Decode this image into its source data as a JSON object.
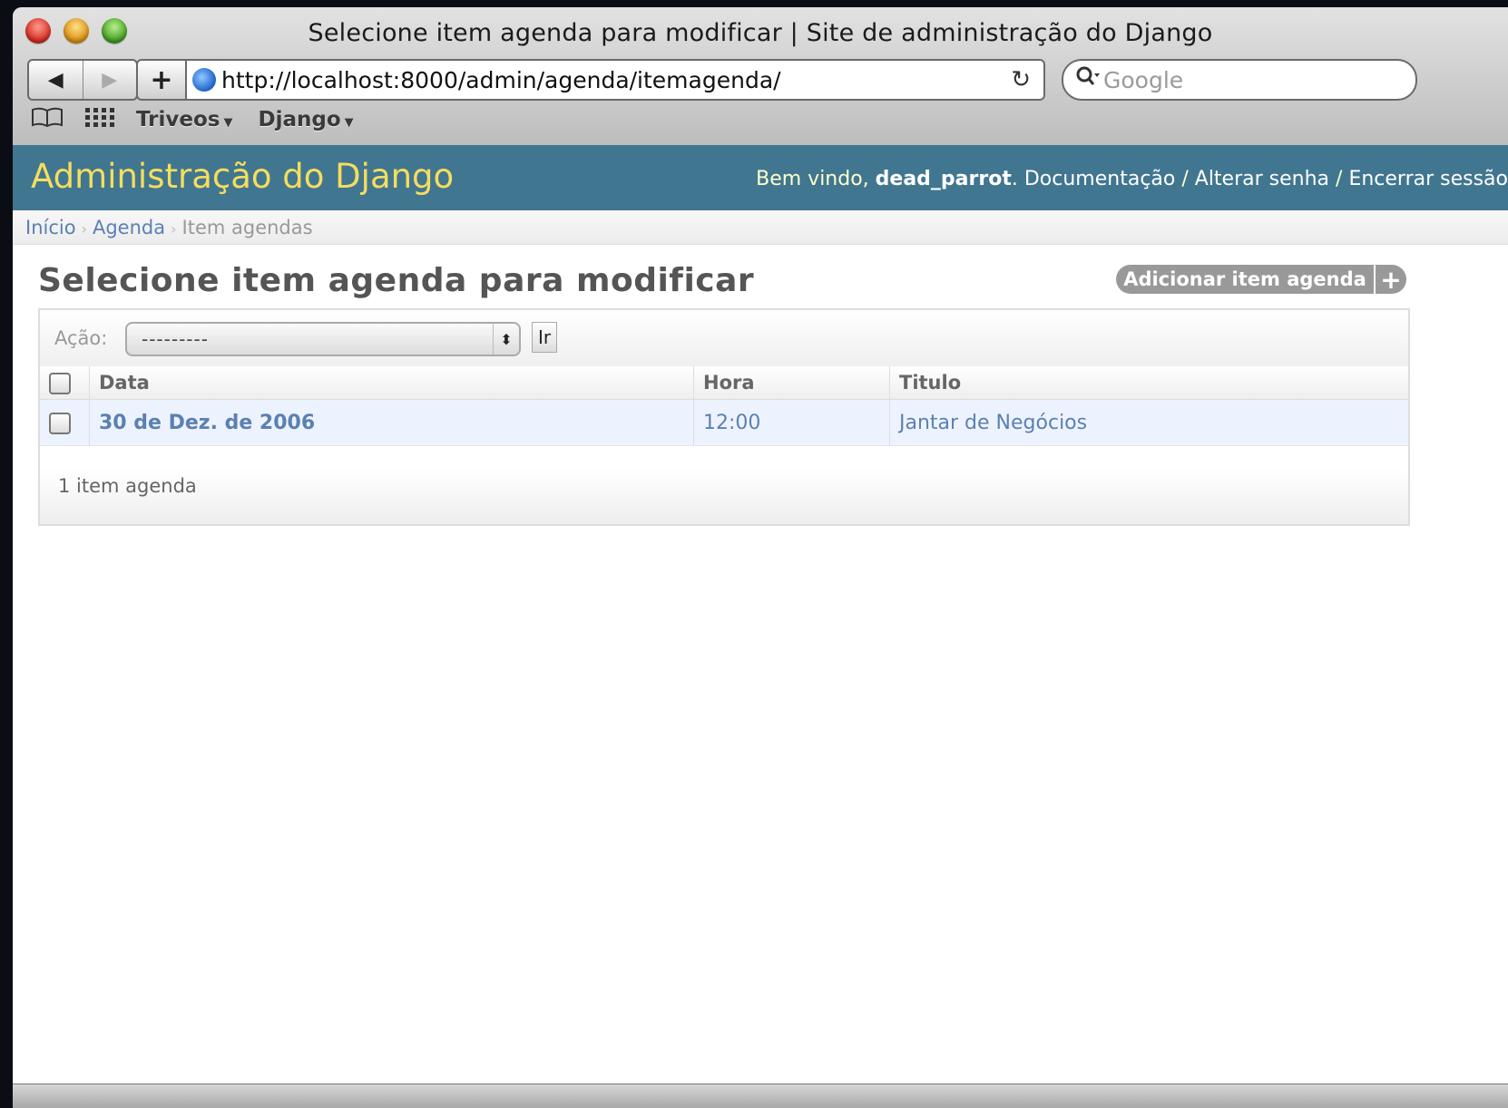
{
  "window": {
    "title": "Selecione item agenda para modificar | Site de administração do Django"
  },
  "toolbar": {
    "back_symbol": "◀",
    "forward_symbol": "▶",
    "add_symbol": "+",
    "url": "http://localhost:8000/admin/agenda/itemagenda/",
    "reload_symbol": "↻",
    "search_placeholder": "Google"
  },
  "bookmarks": {
    "items": [
      {
        "label": "Triveos"
      },
      {
        "label": "Django"
      }
    ]
  },
  "django": {
    "branding": "Administração do Django",
    "welcome": "Bem vindo, ",
    "username": "dead_parrot",
    "links": [
      "Documentação",
      "Alterar senha",
      "Encerrar sessão"
    ],
    "separator": " / "
  },
  "breadcrumbs": {
    "items": [
      "Início",
      "Agenda",
      "Item agendas"
    ],
    "separator": "›"
  },
  "content": {
    "title": "Selecione item agenda para modificar",
    "add_button": "Adicionar item agenda",
    "add_icon": "+"
  },
  "actions": {
    "label": "Ação:",
    "selected": "---------",
    "go_button": "Ir"
  },
  "table": {
    "headers": [
      "Data",
      "Hora",
      "Titulo"
    ],
    "rows": [
      {
        "data": "30 de Dez. de 2006",
        "hora": "12:00",
        "titulo": "Jantar de Negócios"
      }
    ]
  },
  "paginator": {
    "count_text": "1 item agenda"
  },
  "colors": {
    "header_bg": "#417690",
    "branding": "#f5dd5d",
    "link": "#5b80b2",
    "row_bg": "#edf3fe"
  }
}
